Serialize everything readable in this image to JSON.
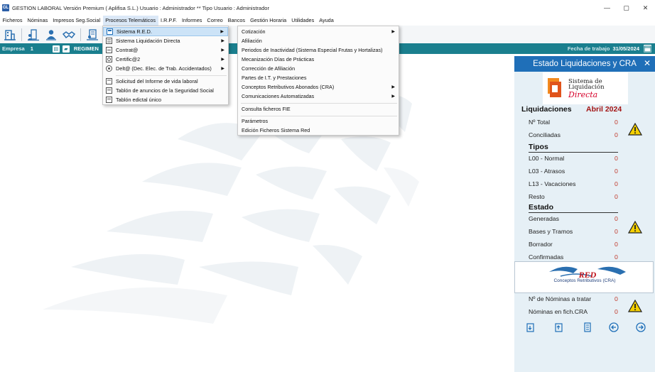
{
  "window": {
    "app_badge": "GL",
    "title": "GESTION LABORAL Versión Premium ( Aplifisa S.L.)   Usuario : Administrador  **  Tipo Usuario : Administrador",
    "controls": {
      "minimize": "—",
      "maximize": "▢",
      "close": "✕"
    }
  },
  "menubar": [
    "Ficheros",
    "Nóminas",
    "Impresos Seg.Social",
    "Procesos Telemáticos",
    "I.R.P.F.",
    "Informes",
    "Correo",
    "Bancos",
    "Gestión Horaria",
    "Utilidades",
    "Ayuda"
  ],
  "toolbar": {
    "icons": [
      "company-icon",
      "employees-icon",
      "user-icon",
      "handshake-icon",
      "document-icon"
    ]
  },
  "statusbar": {
    "empresa_label": "Empresa",
    "empresa_value": "1",
    "regimen_label": "REGIMEN",
    "fecha_label": "Fecha de trabajo",
    "fecha_value": "31/05/2024"
  },
  "menu_telematicos": {
    "items": [
      {
        "label": "Sistema  R.E.D.",
        "icon": "red-system-icon",
        "submenu": true,
        "highlighted": true
      },
      {
        "label": "Sistema Liquidación Directa",
        "icon": "sld-icon",
        "submenu": true
      },
      {
        "label": "Contrat@",
        "icon": "contrata-icon",
        "submenu": true
      },
      {
        "label": "Certific@2",
        "icon": "certifica-icon",
        "submenu": true
      },
      {
        "label": "Delt@ (Dec. Elec. de Trab. Accidentados)",
        "icon": "delta-icon",
        "submenu": true
      },
      {
        "label": "Solicitud del Informe de vida laboral",
        "icon": "vida-laboral-icon",
        "submenu": false
      },
      {
        "label": "Tablón de anuncios de la Seguridad Social",
        "icon": "board-icon",
        "submenu": false
      },
      {
        "label": "Tablón edictal único",
        "icon": "edict-board-icon",
        "submenu": false
      }
    ]
  },
  "menu_red": {
    "items": [
      {
        "label": "Cotización",
        "submenu": true
      },
      {
        "label": "Afiliación",
        "submenu": false
      },
      {
        "label": "Periodos de Inactividad (Sistema Especial Frutas y Hortalizas)",
        "submenu": false
      },
      {
        "label": "Mecanización Días de Prácticas",
        "submenu": false
      },
      {
        "label": "Corrección de Afiliación",
        "submenu": false
      },
      {
        "label": "Partes de I.T. y Prestaciones",
        "submenu": false
      },
      {
        "label": "Conceptos Retributivos Abonados (CRA)",
        "submenu": true
      },
      {
        "label": "Comunicaciones Automatizadas",
        "submenu": true
      },
      {
        "label": "Consulta ficheros FIE",
        "submenu": false
      },
      {
        "label": "Parámetros",
        "submenu": false
      },
      {
        "label": "Edición Ficheros Sistema Red",
        "submenu": false
      }
    ]
  },
  "panel": {
    "header": "Estado Liquidaciones y CRA",
    "close": "✕",
    "sld_logo": {
      "line1": "Sistema de",
      "line2": "Liquidación",
      "line3": "Directa"
    },
    "liquidaciones_title": "Liquidaciones",
    "month": "Abril 2024",
    "rows_top": [
      {
        "label": "Nº Total",
        "value": "0"
      },
      {
        "label": "Conciliadas",
        "value": "0"
      }
    ],
    "tipos_title": "Tipos",
    "tipos": [
      {
        "label": "L00 - Normal",
        "value": "0"
      },
      {
        "label": "L03 - Atrasos",
        "value": "0"
      },
      {
        "label": "L13 - Vacaciones",
        "value": "0"
      },
      {
        "label": "Resto",
        "value": "0"
      }
    ],
    "estado_title": "Estado",
    "estado": [
      {
        "label": "Generadas",
        "value": "0"
      },
      {
        "label": "Bases y Tramos",
        "value": "0"
      },
      {
        "label": "Borrador",
        "value": "0"
      },
      {
        "label": "Confirmadas",
        "value": "0"
      }
    ],
    "red_logo": {
      "word": "RED",
      "caption": "Conceptos Retributivos (CRA)"
    },
    "cra_rows": [
      {
        "label": "Nº de Nóminas a tratar",
        "value": "0"
      },
      {
        "label": "Nóminas en fich.CRA",
        "value": "0"
      }
    ],
    "footer_icons": [
      "export-icon",
      "import-icon",
      "report-icon",
      "previous-icon",
      "next-icon"
    ],
    "accent": "#1f6fb8",
    "warning_color": "#f5d000"
  }
}
